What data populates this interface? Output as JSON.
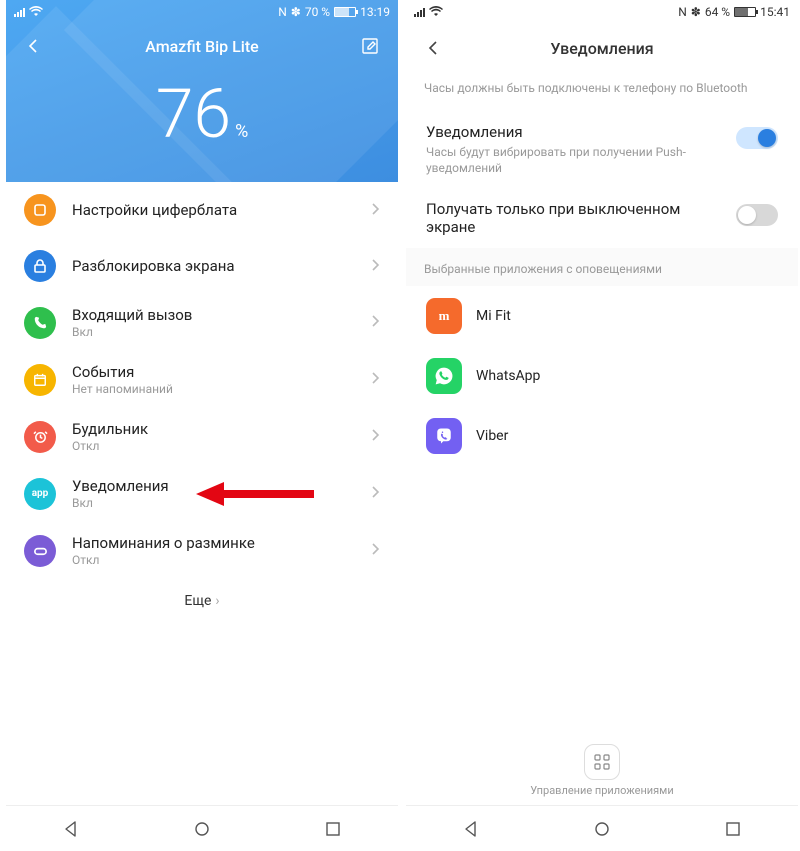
{
  "left": {
    "status": {
      "battery_pct": "70 %",
      "time": "13:19",
      "nfc": "N",
      "bt": "✽"
    },
    "title": "Amazfit Bip Lite",
    "charge_pct": "76",
    "charge_unit": "%",
    "rows": [
      {
        "icon": "watchface-icon",
        "bg": "bg-orange",
        "title": "Настройки циферблата",
        "sub": ""
      },
      {
        "icon": "lock-icon",
        "bg": "bg-blue",
        "title": "Разблокировка экрана",
        "sub": ""
      },
      {
        "icon": "phone-icon",
        "bg": "bg-green",
        "title": "Входящий вызов",
        "sub": "Вкл"
      },
      {
        "icon": "calendar-icon",
        "bg": "bg-yellow",
        "title": "События",
        "sub": "Нет напоминаний"
      },
      {
        "icon": "alarm-icon",
        "bg": "bg-red",
        "title": "Будильник",
        "sub": "Откл"
      },
      {
        "icon": "app-icon",
        "bg": "bg-teal",
        "title": "Уведомления",
        "sub": "Вкл",
        "arrow": true
      },
      {
        "icon": "stretch-icon",
        "bg": "bg-purple",
        "title": "Напоминания о разминке",
        "sub": "Откл"
      }
    ],
    "more_label": "Еще"
  },
  "right": {
    "status": {
      "battery_pct": "64 %",
      "time": "15:41",
      "nfc": "N",
      "bt": "✽"
    },
    "title": "Уведомления",
    "info": "Часы должны быть подключены к телефону по Bluetooth",
    "settings": [
      {
        "title": "Уведомления",
        "sub": "Часы будут вибрировать при получении Push-уведомлений",
        "on": true
      },
      {
        "title": "Получать только при выключенном экране",
        "sub": "",
        "on": false
      }
    ],
    "section_head": "Выбранные приложения с оповещениями",
    "apps": [
      {
        "name": "Mi Fit",
        "bg": "bg-mifit",
        "glyph": "m"
      },
      {
        "name": "WhatsApp",
        "bg": "bg-wa",
        "glyph": "✆"
      },
      {
        "name": "Viber",
        "bg": "bg-viber",
        "glyph": "✆"
      }
    ],
    "manage_label": "Управление приложениями"
  }
}
